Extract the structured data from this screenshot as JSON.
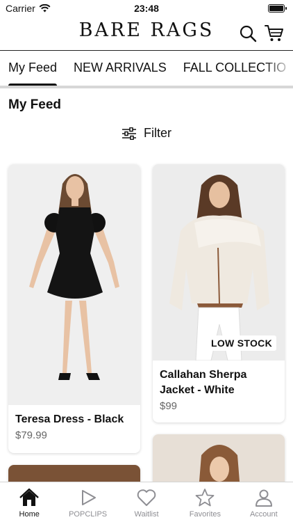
{
  "status": {
    "carrier": "Carrier",
    "time": "23:48"
  },
  "header": {
    "brand": "BARE RAGS"
  },
  "tabs": [
    {
      "label": "My Feed",
      "active": true
    },
    {
      "label": "NEW ARRIVALS",
      "active": false
    },
    {
      "label": "FALL COLLECTIO",
      "active": false
    }
  ],
  "feed": {
    "title": "My Feed",
    "filter_label": "Filter"
  },
  "products": [
    {
      "name": "Teresa Dress - Black",
      "price": "$79.99",
      "badge": ""
    },
    {
      "name": "Callahan Sherpa Jacket - White",
      "price": "$99",
      "badge": "LOW STOCK"
    }
  ],
  "tabbar": [
    {
      "label": "Home",
      "icon": "home-icon",
      "active": true
    },
    {
      "label": "POPCLIPS",
      "icon": "play-icon",
      "active": false
    },
    {
      "label": "Waitlist",
      "icon": "heart-icon",
      "active": false
    },
    {
      "label": "Favorites",
      "icon": "star-icon",
      "active": false
    },
    {
      "label": "Account",
      "icon": "person-icon",
      "active": false
    }
  ],
  "colors": {
    "accent": "#111111",
    "inactive": "#8e8e93",
    "divider": "#d7d7d7"
  }
}
